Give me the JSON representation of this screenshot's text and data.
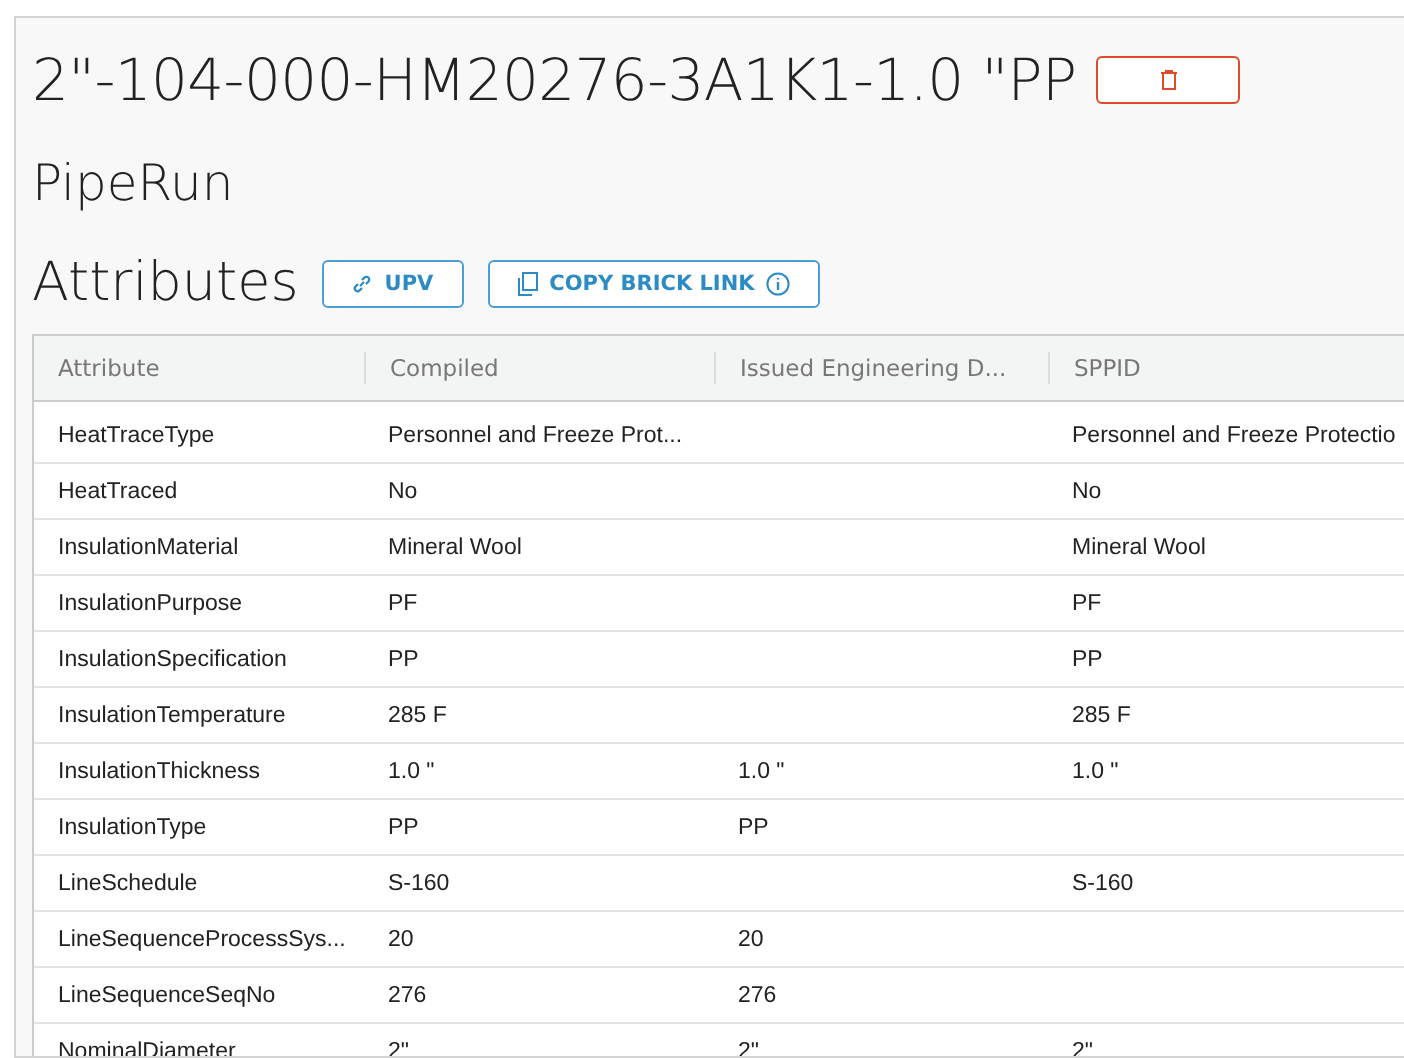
{
  "title": "2\"-104-000-HM20276-3A1K1-1.0 \"PP",
  "type_label": "PipeRun",
  "section": {
    "title": "Attributes",
    "buttons": [
      {
        "label": "UPV",
        "kind": "link"
      },
      {
        "label": "COPY BRICK LINK",
        "kind": "copy"
      }
    ]
  },
  "table": {
    "columns": [
      "Attribute",
      "Compiled",
      "Issued Engineering D...",
      "SPPID"
    ],
    "rows": [
      [
        "HeatTraceType",
        "Personnel and Freeze Prot...",
        "",
        "Personnel and Freeze Protectio"
      ],
      [
        "HeatTraced",
        "No",
        "",
        "No"
      ],
      [
        "InsulationMaterial",
        "Mineral Wool",
        "",
        "Mineral Wool"
      ],
      [
        "InsulationPurpose",
        "PF",
        "",
        "PF"
      ],
      [
        "InsulationSpecification",
        "PP",
        "",
        "PP"
      ],
      [
        "InsulationTemperature",
        "285 F",
        "",
        "285 F"
      ],
      [
        "InsulationThickness",
        "1.0 \"",
        "1.0 \"",
        "1.0 \""
      ],
      [
        "InsulationType",
        "PP",
        "PP",
        ""
      ],
      [
        "LineSchedule",
        "S-160",
        "",
        "S-160"
      ],
      [
        "LineSequenceProcessSys...",
        "20",
        "20",
        ""
      ],
      [
        "LineSequenceSeqNo",
        "276",
        "276",
        ""
      ],
      [
        "NominalDiameter",
        "2\"",
        "2\"",
        "2\""
      ]
    ]
  }
}
